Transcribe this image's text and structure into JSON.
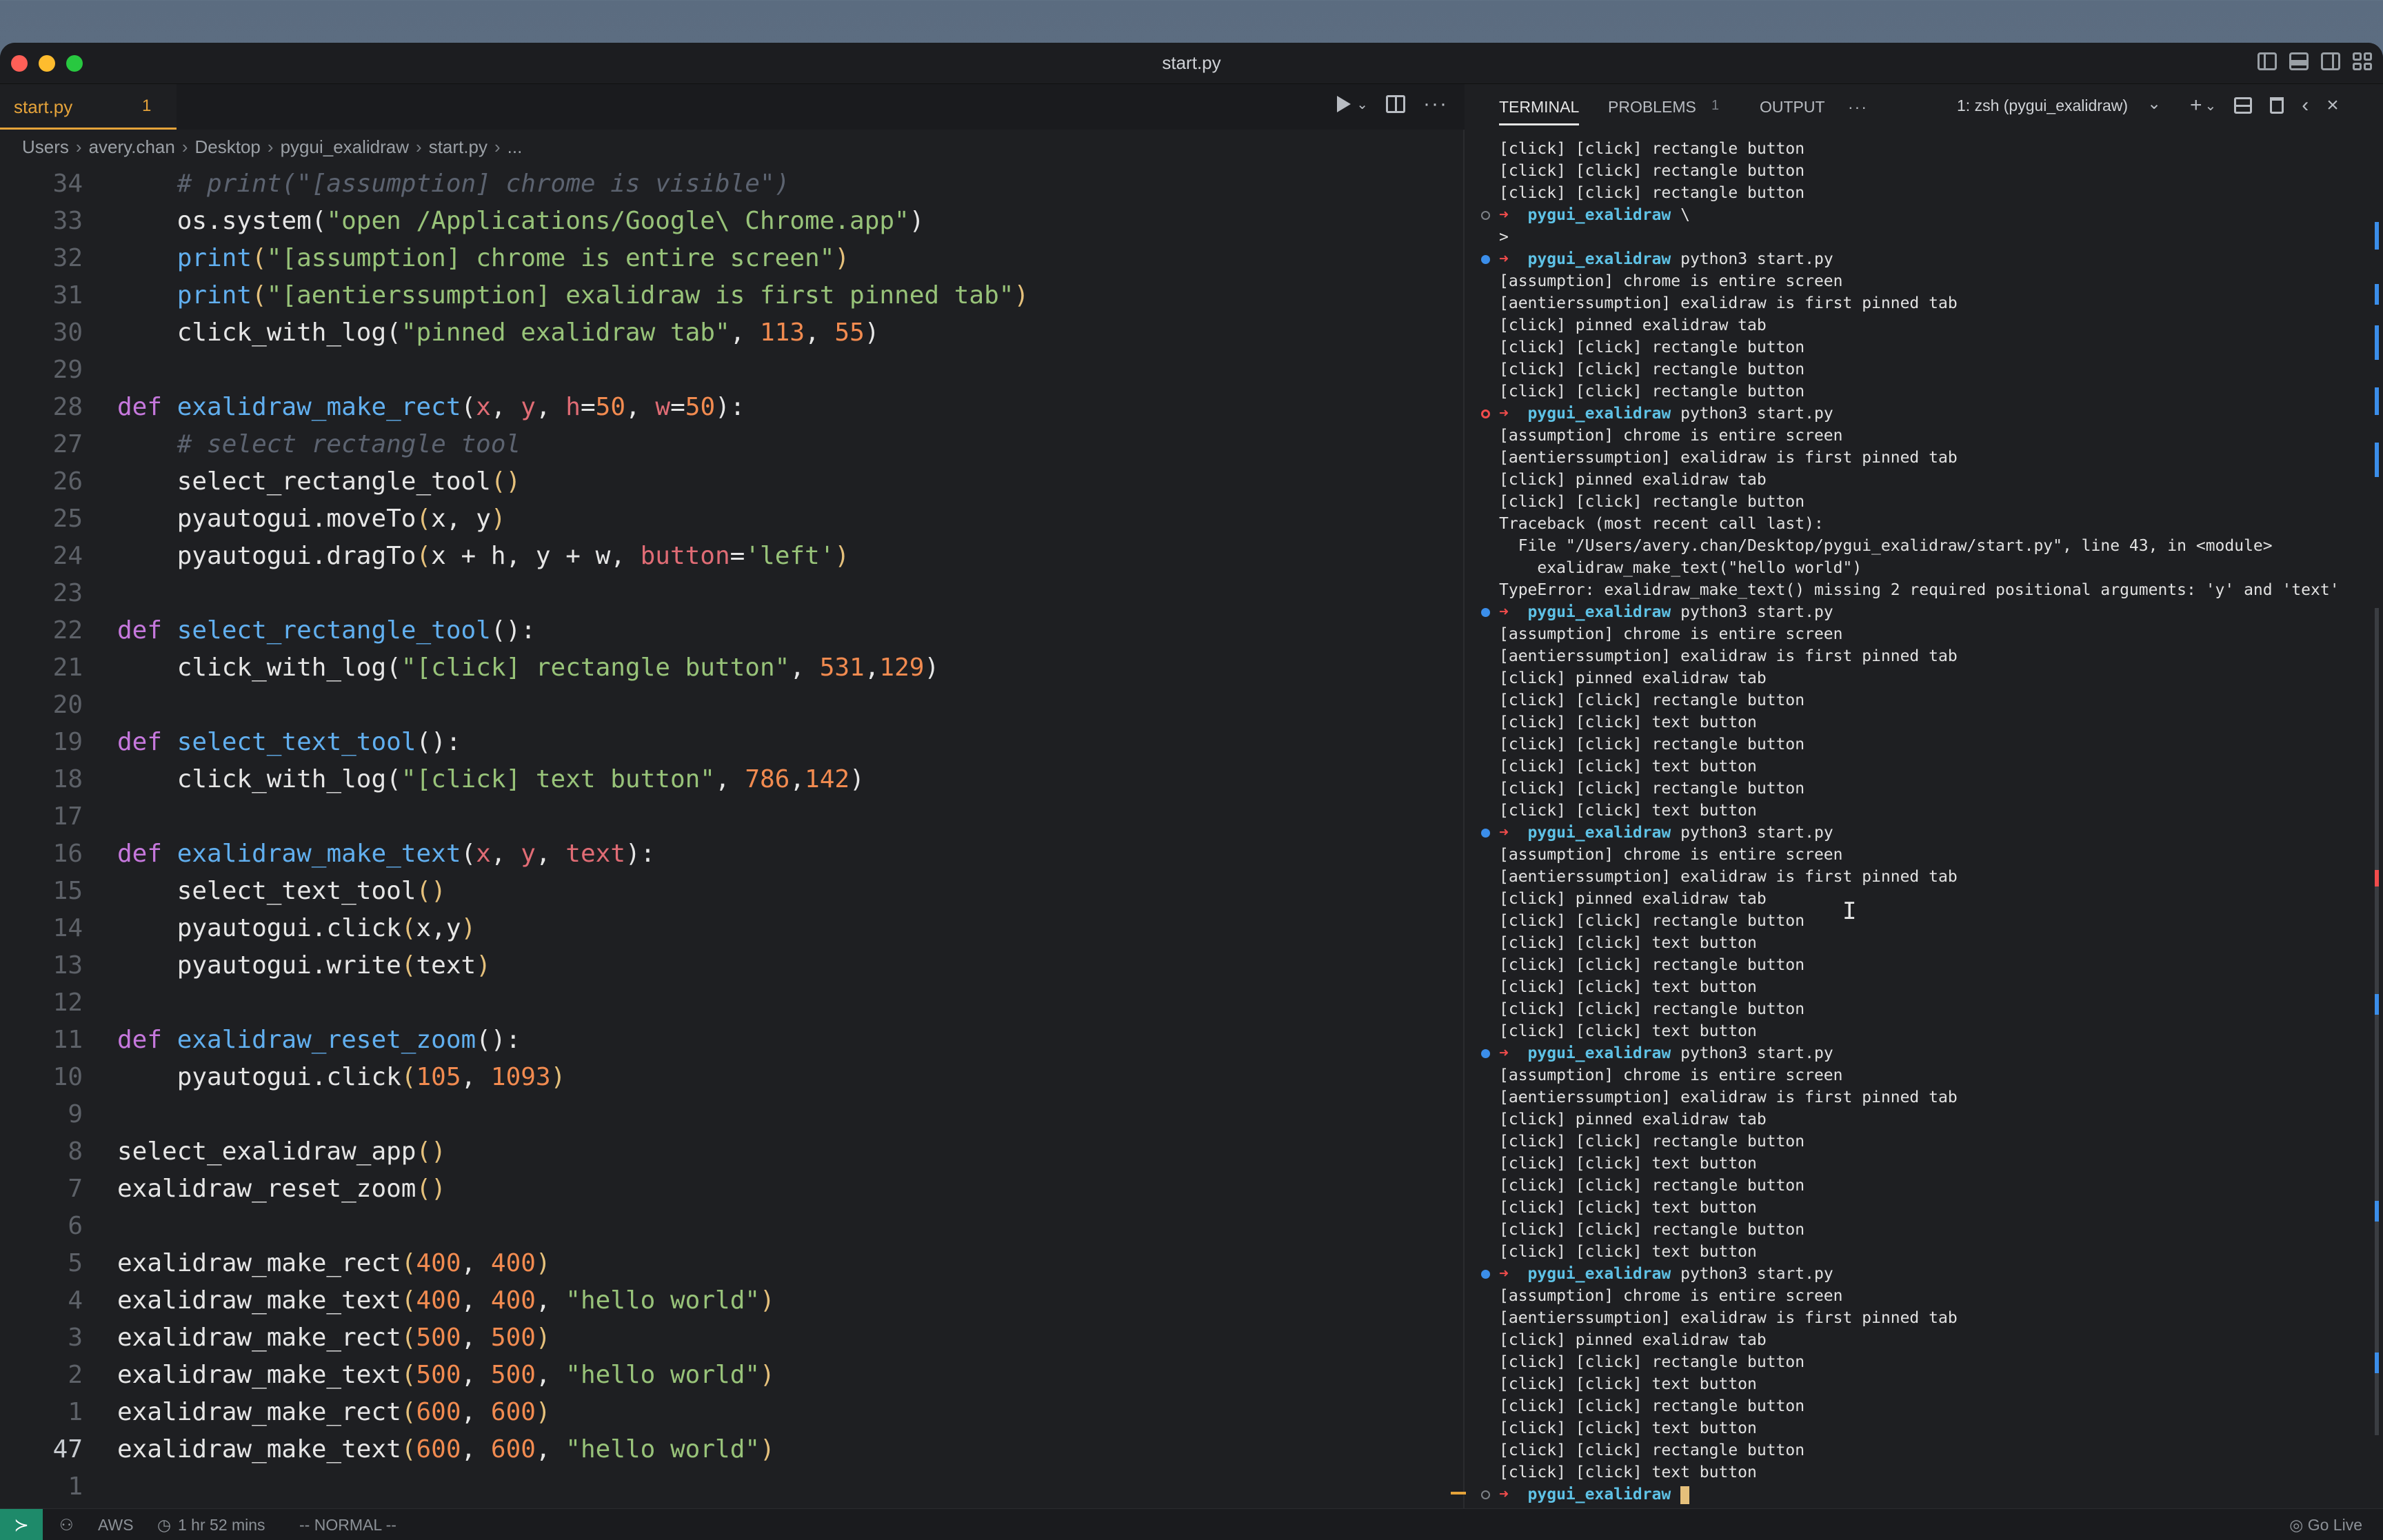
{
  "window": {
    "title": "start.py"
  },
  "editor": {
    "tab": {
      "name": "start.py",
      "count": "1"
    },
    "breadcrumb": [
      "Users",
      "avery.chan",
      "Desktop",
      "pygui_exalidraw",
      "start.py",
      "..."
    ]
  },
  "code_lines": [
    {
      "n": "34",
      "t": [
        [
          "cmt",
          "    # print(\"[assumption] chrome is visible\")"
        ]
      ]
    },
    {
      "n": "33",
      "t": [
        [
          "plain",
          "    os.system("
        ],
        [
          "str",
          "\"open /Applications/Google\\ Chrome.app\""
        ],
        [
          "plain",
          ")"
        ]
      ]
    },
    {
      "n": "32",
      "t": [
        [
          "plain",
          "    "
        ],
        [
          "fn",
          "print"
        ],
        [
          "par",
          "("
        ],
        [
          "str",
          "\"[assumption] chrome is entire screen\""
        ],
        [
          "par",
          ")"
        ]
      ]
    },
    {
      "n": "31",
      "t": [
        [
          "plain",
          "    "
        ],
        [
          "fn",
          "print"
        ],
        [
          "par",
          "("
        ],
        [
          "str",
          "\"[aentierssumption] exalidraw is first pinned tab\""
        ],
        [
          "par",
          ")"
        ]
      ]
    },
    {
      "n": "30",
      "t": [
        [
          "plain",
          "    click_with_log("
        ],
        [
          "str",
          "\"pinned exalidraw tab\""
        ],
        [
          "plain",
          ", "
        ],
        [
          "num",
          "113"
        ],
        [
          "plain",
          ", "
        ],
        [
          "num",
          "55"
        ],
        [
          "plain",
          ")"
        ]
      ]
    },
    {
      "n": "29",
      "t": []
    },
    {
      "n": "28",
      "t": [
        [
          "kw",
          "def "
        ],
        [
          "fn",
          "exalidraw_make_rect"
        ],
        [
          "plain",
          "("
        ],
        [
          "prm",
          "x"
        ],
        [
          "plain",
          ", "
        ],
        [
          "prm",
          "y"
        ],
        [
          "plain",
          ", "
        ],
        [
          "prm",
          "h"
        ],
        [
          "plain",
          "="
        ],
        [
          "num",
          "50"
        ],
        [
          "plain",
          ", "
        ],
        [
          "prm",
          "w"
        ],
        [
          "plain",
          "="
        ],
        [
          "num",
          "50"
        ],
        [
          "plain",
          "):"
        ]
      ]
    },
    {
      "n": "27",
      "t": [
        [
          "cmt",
          "    # select rectangle tool"
        ]
      ]
    },
    {
      "n": "26",
      "t": [
        [
          "plain",
          "    select_rectangle_tool"
        ],
        [
          "par",
          "()"
        ]
      ]
    },
    {
      "n": "25",
      "t": [
        [
          "plain",
          "    pyautogui.moveTo"
        ],
        [
          "par",
          "("
        ],
        [
          "plain",
          "x, y"
        ],
        [
          "par",
          ")"
        ]
      ]
    },
    {
      "n": "24",
      "t": [
        [
          "plain",
          "    pyautogui.dragTo"
        ],
        [
          "par",
          "("
        ],
        [
          "plain",
          "x + h, y + w, "
        ],
        [
          "prm",
          "button"
        ],
        [
          "plain",
          "="
        ],
        [
          "str",
          "'left'"
        ],
        [
          "par",
          ")"
        ]
      ]
    },
    {
      "n": "23",
      "t": []
    },
    {
      "n": "22",
      "t": [
        [
          "kw",
          "def "
        ],
        [
          "fn",
          "select_rectangle_tool"
        ],
        [
          "plain",
          "():"
        ]
      ]
    },
    {
      "n": "21",
      "t": [
        [
          "plain",
          "    click_with_log("
        ],
        [
          "str",
          "\"[click] rectangle button\""
        ],
        [
          "plain",
          ", "
        ],
        [
          "num",
          "531"
        ],
        [
          "plain",
          ","
        ],
        [
          "num",
          "129"
        ],
        [
          "plain",
          ")"
        ]
      ]
    },
    {
      "n": "20",
      "t": []
    },
    {
      "n": "19",
      "t": [
        [
          "kw",
          "def "
        ],
        [
          "fn",
          "select_text_tool"
        ],
        [
          "plain",
          "():"
        ]
      ]
    },
    {
      "n": "18",
      "t": [
        [
          "plain",
          "    click_with_log("
        ],
        [
          "str",
          "\"[click] text button\""
        ],
        [
          "plain",
          ", "
        ],
        [
          "num",
          "786"
        ],
        [
          "plain",
          ","
        ],
        [
          "num",
          "142"
        ],
        [
          "plain",
          ")"
        ]
      ]
    },
    {
      "n": "17",
      "t": []
    },
    {
      "n": "16",
      "t": [
        [
          "kw",
          "def "
        ],
        [
          "fn",
          "exalidraw_make_text"
        ],
        [
          "plain",
          "("
        ],
        [
          "prm",
          "x"
        ],
        [
          "plain",
          ", "
        ],
        [
          "prm",
          "y"
        ],
        [
          "plain",
          ", "
        ],
        [
          "prm",
          "text"
        ],
        [
          "plain",
          "):"
        ]
      ]
    },
    {
      "n": "15",
      "t": [
        [
          "plain",
          "    select_text_tool"
        ],
        [
          "par",
          "()"
        ]
      ]
    },
    {
      "n": "14",
      "t": [
        [
          "plain",
          "    pyautogui.click"
        ],
        [
          "par",
          "("
        ],
        [
          "plain",
          "x,y"
        ],
        [
          "par",
          ")"
        ]
      ]
    },
    {
      "n": "13",
      "t": [
        [
          "plain",
          "    pyautogui.write"
        ],
        [
          "par",
          "("
        ],
        [
          "plain",
          "text"
        ],
        [
          "par",
          ")"
        ]
      ]
    },
    {
      "n": "12",
      "t": []
    },
    {
      "n": "11",
      "t": [
        [
          "kw",
          "def "
        ],
        [
          "fn",
          "exalidraw_reset_zoom"
        ],
        [
          "plain",
          "():"
        ]
      ]
    },
    {
      "n": "10",
      "t": [
        [
          "plain",
          "    pyautogui.click"
        ],
        [
          "par",
          "("
        ],
        [
          "num",
          "105"
        ],
        [
          "plain",
          ", "
        ],
        [
          "num",
          "1093"
        ],
        [
          "par",
          ")"
        ]
      ]
    },
    {
      "n": "9",
      "t": []
    },
    {
      "n": "8",
      "t": [
        [
          "plain",
          "select_exalidraw_app"
        ],
        [
          "par",
          "()"
        ]
      ]
    },
    {
      "n": "7",
      "t": [
        [
          "plain",
          "exalidraw_reset_zoom"
        ],
        [
          "par",
          "()"
        ]
      ]
    },
    {
      "n": "6",
      "t": []
    },
    {
      "n": "5",
      "t": [
        [
          "plain",
          "exalidraw_make_rect"
        ],
        [
          "par",
          "("
        ],
        [
          "num",
          "400"
        ],
        [
          "plain",
          ", "
        ],
        [
          "num",
          "400"
        ],
        [
          "par",
          ")"
        ]
      ]
    },
    {
      "n": "4",
      "t": [
        [
          "plain",
          "exalidraw_make_text"
        ],
        [
          "par",
          "("
        ],
        [
          "num",
          "400"
        ],
        [
          "plain",
          ", "
        ],
        [
          "num",
          "400"
        ],
        [
          "plain",
          ", "
        ],
        [
          "str",
          "\"hello world\""
        ],
        [
          "par",
          ")"
        ]
      ]
    },
    {
      "n": "3",
      "t": [
        [
          "plain",
          "exalidraw_make_rect"
        ],
        [
          "par",
          "("
        ],
        [
          "num",
          "500"
        ],
        [
          "plain",
          ", "
        ],
        [
          "num",
          "500"
        ],
        [
          "par",
          ")"
        ]
      ]
    },
    {
      "n": "2",
      "t": [
        [
          "plain",
          "exalidraw_make_text"
        ],
        [
          "par",
          "("
        ],
        [
          "num",
          "500"
        ],
        [
          "plain",
          ", "
        ],
        [
          "num",
          "500"
        ],
        [
          "plain",
          ", "
        ],
        [
          "str",
          "\"hello world\""
        ],
        [
          "par",
          ")"
        ]
      ]
    },
    {
      "n": "1",
      "t": [
        [
          "plain",
          "exalidraw_make_rect"
        ],
        [
          "par",
          "("
        ],
        [
          "num",
          "600"
        ],
        [
          "plain",
          ", "
        ],
        [
          "num",
          "600"
        ],
        [
          "par",
          ")"
        ]
      ]
    },
    {
      "n": "47",
      "cur": true,
      "t": [
        [
          "plain",
          "exalidraw_make_text"
        ],
        [
          "par",
          "("
        ],
        [
          "num",
          "600"
        ],
        [
          "plain",
          ", "
        ],
        [
          "num",
          "600"
        ],
        [
          "plain",
          ", "
        ],
        [
          "str",
          "\"hello world\""
        ],
        [
          "par",
          ")"
        ]
      ]
    },
    {
      "n": "1",
      "t": []
    }
  ],
  "panel": {
    "tabs": {
      "terminal": "TERMINAL",
      "problems": "PROBLEMS",
      "problems_count": "1",
      "output": "OUTPUT",
      "more": "···"
    },
    "terminal_select": "1: zsh (pygui_exalidraw)",
    "icons": [
      "plus-icon",
      "split-terminal-icon",
      "trash-icon",
      "chevron-left-icon",
      "close-icon"
    ]
  },
  "terminal_lines": [
    {
      "k": "out",
      "t": "[click] [click] rectangle button"
    },
    {
      "k": "out",
      "t": "[click] [click] rectangle button"
    },
    {
      "k": "out",
      "t": "[click] [click] rectangle button"
    },
    {
      "k": "prompt",
      "m": "hollow",
      "dir": "pygui_exalidraw",
      "cmd": " \\"
    },
    {
      "k": "out",
      "t": ">"
    },
    {
      "k": "prompt",
      "m": "blue",
      "dir": "pygui_exalidraw",
      "cmd": " python3 start.py"
    },
    {
      "k": "out",
      "t": "[assumption] chrome is entire screen"
    },
    {
      "k": "out",
      "t": "[aentierssumption] exalidraw is first pinned tab"
    },
    {
      "k": "out",
      "t": "[click] pinned exalidraw tab"
    },
    {
      "k": "out",
      "t": "[click] [click] rectangle button"
    },
    {
      "k": "out",
      "t": "[click] [click] rectangle button"
    },
    {
      "k": "out",
      "t": "[click] [click] rectangle button"
    },
    {
      "k": "prompt",
      "m": "red",
      "dir": "pygui_exalidraw",
      "cmd": " python3 start.py"
    },
    {
      "k": "out",
      "t": "[assumption] chrome is entire screen"
    },
    {
      "k": "out",
      "t": "[aentierssumption] exalidraw is first pinned tab"
    },
    {
      "k": "out",
      "t": "[click] pinned exalidraw tab"
    },
    {
      "k": "out",
      "t": "[click] [click] rectangle button"
    },
    {
      "k": "out",
      "t": "Traceback (most recent call last):"
    },
    {
      "k": "out",
      "t": "  File \"/Users/avery.chan/Desktop/pygui_exalidraw/start.py\", line 43, in <module>"
    },
    {
      "k": "out",
      "t": "    exalidraw_make_text(\"hello world\")"
    },
    {
      "k": "out",
      "t": "TypeError: exalidraw_make_text() missing 2 required positional arguments: 'y' and 'text'"
    },
    {
      "k": "prompt",
      "m": "blue",
      "dir": "pygui_exalidraw",
      "cmd": " python3 start.py"
    },
    {
      "k": "out",
      "t": "[assumption] chrome is entire screen"
    },
    {
      "k": "out",
      "t": "[aentierssumption] exalidraw is first pinned tab"
    },
    {
      "k": "out",
      "t": "[click] pinned exalidraw tab"
    },
    {
      "k": "out",
      "t": "[click] [click] rectangle button"
    },
    {
      "k": "out",
      "t": "[click] [click] text button"
    },
    {
      "k": "out",
      "t": "[click] [click] rectangle button"
    },
    {
      "k": "out",
      "t": "[click] [click] text button"
    },
    {
      "k": "out",
      "t": "[click] [click] rectangle button"
    },
    {
      "k": "out",
      "t": "[click] [click] text button"
    },
    {
      "k": "prompt",
      "m": "blue",
      "dir": "pygui_exalidraw",
      "cmd": " python3 start.py"
    },
    {
      "k": "out",
      "t": "[assumption] chrome is entire screen"
    },
    {
      "k": "out",
      "t": "[aentierssumption] exalidraw is first pinned tab"
    },
    {
      "k": "out",
      "t": "[click] pinned exalidraw tab"
    },
    {
      "k": "out",
      "t": "[click] [click] rectangle button"
    },
    {
      "k": "out",
      "t": "[click] [click] text button"
    },
    {
      "k": "out",
      "t": "[click] [click] rectangle button"
    },
    {
      "k": "out",
      "t": "[click] [click] text button"
    },
    {
      "k": "out",
      "t": "[click] [click] rectangle button"
    },
    {
      "k": "out",
      "t": "[click] [click] text button"
    },
    {
      "k": "prompt",
      "m": "blue",
      "dir": "pygui_exalidraw",
      "cmd": " python3 start.py"
    },
    {
      "k": "out",
      "t": "[assumption] chrome is entire screen"
    },
    {
      "k": "out",
      "t": "[aentierssumption] exalidraw is first pinned tab"
    },
    {
      "k": "out",
      "t": "[click] pinned exalidraw tab"
    },
    {
      "k": "out",
      "t": "[click] [click] rectangle button"
    },
    {
      "k": "out",
      "t": "[click] [click] text button"
    },
    {
      "k": "out",
      "t": "[click] [click] rectangle button"
    },
    {
      "k": "out",
      "t": "[click] [click] text button"
    },
    {
      "k": "out",
      "t": "[click] [click] rectangle button"
    },
    {
      "k": "out",
      "t": "[click] [click] text button"
    },
    {
      "k": "prompt",
      "m": "blue",
      "dir": "pygui_exalidraw",
      "cmd": " python3 start.py"
    },
    {
      "k": "out",
      "t": "[assumption] chrome is entire screen"
    },
    {
      "k": "out",
      "t": "[aentierssumption] exalidraw is first pinned tab"
    },
    {
      "k": "out",
      "t": "[click] pinned exalidraw tab"
    },
    {
      "k": "out",
      "t": "[click] [click] rectangle button"
    },
    {
      "k": "out",
      "t": "[click] [click] text button"
    },
    {
      "k": "out",
      "t": "[click] [click] rectangle button"
    },
    {
      "k": "out",
      "t": "[click] [click] text button"
    },
    {
      "k": "out",
      "t": "[click] [click] rectangle button"
    },
    {
      "k": "out",
      "t": "[click] [click] text button"
    },
    {
      "k": "prompt",
      "m": "hollow",
      "dir": "pygui_exalidraw",
      "cmd": " ",
      "cursor": true
    }
  ],
  "statusbar": {
    "aws": "AWS",
    "time": "1 hr 52 mins",
    "mode": "-- NORMAL --",
    "golive": "Go Live"
  },
  "colors": {
    "accent": "#e5a33a",
    "keyword": "#c678dd",
    "function": "#61afef",
    "string": "#98c379",
    "number": "#f28b50",
    "param": "#e06c75",
    "terminal_dir": "#5ec2e6",
    "prompt_arrow": "#f14c4c"
  }
}
